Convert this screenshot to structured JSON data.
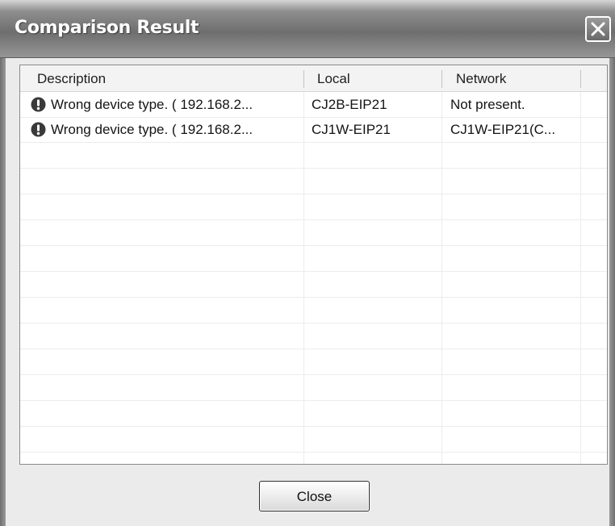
{
  "window": {
    "title": "Comparison Result"
  },
  "table": {
    "columns": [
      "Description",
      "Local",
      "Network"
    ],
    "rows": [
      {
        "icon": "warning-icon",
        "description": "Wrong device type. ( 192.168.2...",
        "local": "CJ2B-EIP21",
        "network": "Not present."
      },
      {
        "icon": "warning-icon",
        "description": "Wrong device type. ( 192.168.2...",
        "local": "CJ1W-EIP21",
        "network": "CJ1W-EIP21(C..."
      }
    ]
  },
  "buttons": {
    "close_label": "Close"
  },
  "colors": {
    "warning_icon": "#3a3a3a"
  }
}
